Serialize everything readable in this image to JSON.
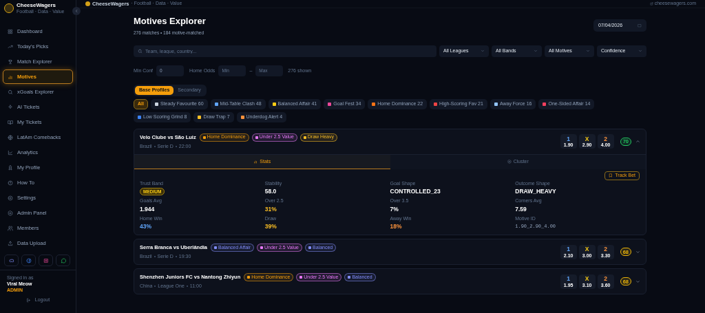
{
  "sidebar": {
    "brand": {
      "name": "CheeseWagers",
      "tagline": "Football · Data · Value"
    },
    "items": [
      {
        "label": "Dashboard",
        "selected": false
      },
      {
        "label": "Today's Picks",
        "selected": false
      },
      {
        "label": "Match Explorer",
        "selected": false
      },
      {
        "label": "Motives",
        "selected": true
      },
      {
        "label": "xGoals Explorer",
        "selected": false
      },
      {
        "label": "AI Tickets",
        "selected": false
      },
      {
        "label": "My Tickets",
        "selected": false
      },
      {
        "label": "LatAm Comebacks",
        "selected": false
      },
      {
        "label": "Analytics",
        "selected": false
      },
      {
        "label": "My Profile",
        "selected": false
      },
      {
        "label": "How To",
        "selected": false
      },
      {
        "label": "Settings",
        "selected": false
      },
      {
        "label": "Admin Panel",
        "selected": false
      },
      {
        "label": "Members",
        "selected": false
      },
      {
        "label": "Data Upload",
        "selected": false
      }
    ],
    "user": {
      "caption": "Signed in as",
      "name": "Viral Meow",
      "role": "ADMIN"
    },
    "logout": "Logout"
  },
  "topbar": {
    "brand": "CheeseWagers",
    "tagline": "· Football · Data · Value",
    "link": "cheesewagers.com"
  },
  "header": {
    "title": "Motives Explorer",
    "subtitle": "276 matches • 184 motive-matched",
    "date": "07/04/2026"
  },
  "search": {
    "placeholder": "Team, league, country..."
  },
  "selects": [
    "All Leagues",
    "All Bands",
    "All Motives",
    "Confidence"
  ],
  "filters": {
    "min_conf_label": "Min Conf",
    "min_conf_value": "0",
    "home_odds_label": "Home Odds",
    "min_placeholder": "Min",
    "separator": "–",
    "max_placeholder": "Max",
    "shown": "276 shown"
  },
  "profile_tabs": [
    {
      "label": "Base Profiles",
      "selected": true
    },
    {
      "label": "Secondary",
      "selected": false
    }
  ],
  "chips": [
    {
      "label": "All",
      "selected": true
    },
    {
      "label": "Steady Favourite",
      "count": "60",
      "color": "#cbd5e1",
      "selected": false
    },
    {
      "label": "Mid-Table Clash",
      "count": "48",
      "color": "#60a5fa",
      "selected": false
    },
    {
      "label": "Balanced Affair",
      "count": "41",
      "color": "#facc15",
      "selected": false
    },
    {
      "label": "Goal Fest",
      "count": "34",
      "color": "#ec4899",
      "selected": false
    },
    {
      "label": "Home Dominance",
      "count": "22",
      "color": "#f97316",
      "selected": false
    },
    {
      "label": "High-Scoring Fav",
      "count": "21",
      "color": "#ef4444",
      "selected": false
    },
    {
      "label": "Away Force",
      "count": "16",
      "color": "#93c5fd",
      "selected": false
    },
    {
      "label": "One-Sided Affair",
      "count": "14",
      "color": "#f43f5e",
      "selected": false
    },
    {
      "label": "Low Scoring Grind",
      "count": "8",
      "color": "#3b82f6",
      "selected": false
    },
    {
      "label": "Draw Trap",
      "count": "7",
      "color": "#fbbf24",
      "selected": false
    },
    {
      "label": "Underdog Alert",
      "count": "4",
      "color": "#fb923c",
      "selected": false
    }
  ],
  "matches": [
    {
      "title": "Velo Clube vs São Luiz",
      "tags": [
        {
          "label": "Home Dominance",
          "color": "#f59e0b"
        },
        {
          "label": "Under 2.5 Value",
          "color": "#e879f9"
        },
        {
          "label": "Draw Heavy",
          "color": "#fbbf24"
        }
      ],
      "meta": [
        "Brazil",
        "Serie D",
        "22:00"
      ],
      "odds": [
        {
          "label": "1",
          "value": "1.90",
          "color": "#60a5fa"
        },
        {
          "label": "X",
          "value": "2.90",
          "color": "#facc15"
        },
        {
          "label": "2",
          "value": "4.00",
          "color": "#fb923c"
        }
      ],
      "confidence": {
        "value": "70",
        "color": "#22c55e"
      },
      "expanded": true,
      "tabs": [
        {
          "label": "Stats",
          "selected": true
        },
        {
          "label": "Cluster",
          "selected": false
        }
      ],
      "track_button": "Track Bet",
      "stats": [
        {
          "label": "Trust Band",
          "value": "MEDIUM",
          "kind": "badge"
        },
        {
          "label": "Stability",
          "value": "58.0",
          "kind": "text"
        },
        {
          "label": "Goal Shape",
          "value": "CONTROLLED_23",
          "kind": "text"
        },
        {
          "label": "Outcome Shape",
          "value": "DRAW_HEAVY",
          "kind": "text"
        },
        {
          "label": "Goals Avg",
          "value": "1.944",
          "kind": "text"
        },
        {
          "label": "Over 2.5",
          "value": "31%",
          "kind": "text",
          "color": "#fbbf24"
        },
        {
          "label": "Over 3.5",
          "value": "7%",
          "kind": "text"
        },
        {
          "label": "Corners Avg",
          "value": "7.59",
          "kind": "text"
        },
        {
          "label": "Home Win",
          "value": "43%",
          "kind": "text",
          "color": "#60a5fa"
        },
        {
          "label": "Draw",
          "value": "39%",
          "kind": "text",
          "color": "#fbbf24"
        },
        {
          "label": "Away Win",
          "value": "18%",
          "kind": "text",
          "color": "#fb923c"
        },
        {
          "label": "Motive ID",
          "value": "1.90_2.90_4.00",
          "kind": "code"
        }
      ]
    },
    {
      "title": "Serra Branca vs Uberlândia",
      "tags": [
        {
          "label": "Balanced Affair",
          "color": "#818cf8"
        },
        {
          "label": "Under 2.5 Value",
          "color": "#e879f9"
        },
        {
          "label": "Balanced",
          "color": "#818cf8"
        }
      ],
      "meta": [
        "Brazil",
        "Serie D",
        "19:30"
      ],
      "odds": [
        {
          "label": "1",
          "value": "2.10",
          "color": "#60a5fa"
        },
        {
          "label": "X",
          "value": "3.00",
          "color": "#facc15"
        },
        {
          "label": "2",
          "value": "3.30",
          "color": "#fb923c"
        }
      ],
      "confidence": {
        "value": "68",
        "color": "#eab308"
      },
      "expanded": false
    },
    {
      "title": "Shenzhen Juniors FC vs Nantong Zhiyun",
      "tags": [
        {
          "label": "Home Dominance",
          "color": "#f59e0b"
        },
        {
          "label": "Under 2.5 Value",
          "color": "#e879f9"
        },
        {
          "label": "Balanced",
          "color": "#818cf8"
        }
      ],
      "meta": [
        "China",
        "League One",
        "11:00"
      ],
      "odds": [
        {
          "label": "1",
          "value": "1.95",
          "color": "#60a5fa"
        },
        {
          "label": "X",
          "value": "3.10",
          "color": "#facc15"
        },
        {
          "label": "2",
          "value": "3.60",
          "color": "#fb923c"
        }
      ],
      "confidence": {
        "value": "68",
        "color": "#eab308"
      },
      "expanded": false
    }
  ]
}
